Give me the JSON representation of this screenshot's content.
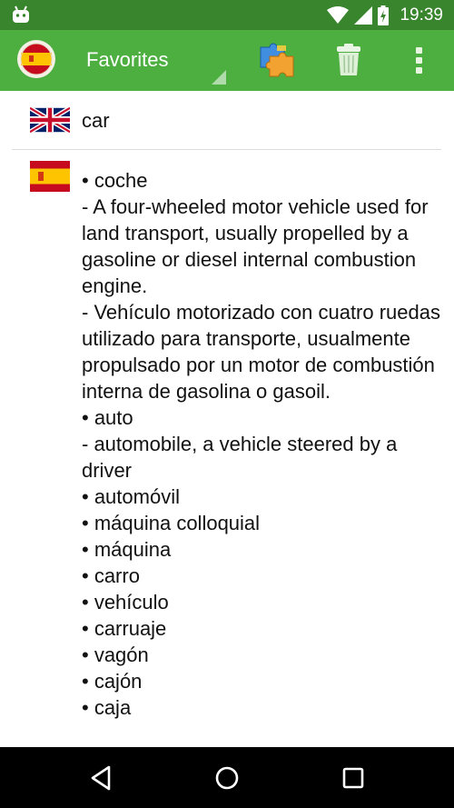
{
  "status_bar": {
    "time": "19:39",
    "icons": [
      "android-icon",
      "wifi-icon",
      "signal-icon",
      "battery-charging-icon"
    ]
  },
  "app_bar": {
    "title": "Favorites",
    "language_icon": "spain-flag-icon",
    "actions": [
      "puzzle-icon",
      "trash-icon",
      "more-vert-icon"
    ]
  },
  "colors": {
    "status_bar": "#39852d",
    "app_bar": "#4caf40",
    "text": "#111111",
    "divider": "#dcdcdc"
  },
  "entry": {
    "source_flag": "uk-flag-icon",
    "term": "car",
    "target_flag": "spain-flag-icon",
    "translations": [
      {
        "text": "• coche",
        "defs": [
          "  - A four-wheeled motor vehicle used for land transport, usually propelled by a gasoline or diesel internal combustion engine.",
          "  - Vehículo motorizado con cuatro ruedas utilizado para transporte, usualmente propulsado por un motor de combustión interna de gasolina o gasoil."
        ]
      },
      {
        "text": "• auto",
        "defs": [
          "  - automobile, a vehicle steered by a driver"
        ]
      },
      {
        "text": "• automóvil",
        "defs": []
      },
      {
        "text": "• máquina colloquial",
        "defs": []
      },
      {
        "text": "• máquina",
        "defs": []
      },
      {
        "text": "• carro",
        "defs": []
      },
      {
        "text": "• vehículo",
        "defs": []
      },
      {
        "text": "• carruaje",
        "defs": []
      },
      {
        "text": "• vagón",
        "defs": []
      },
      {
        "text": "• cajón",
        "defs": []
      },
      {
        "text": "• caja",
        "defs": []
      }
    ]
  },
  "nav_bar": {
    "buttons": [
      "back-icon",
      "home-icon",
      "recents-icon"
    ]
  }
}
